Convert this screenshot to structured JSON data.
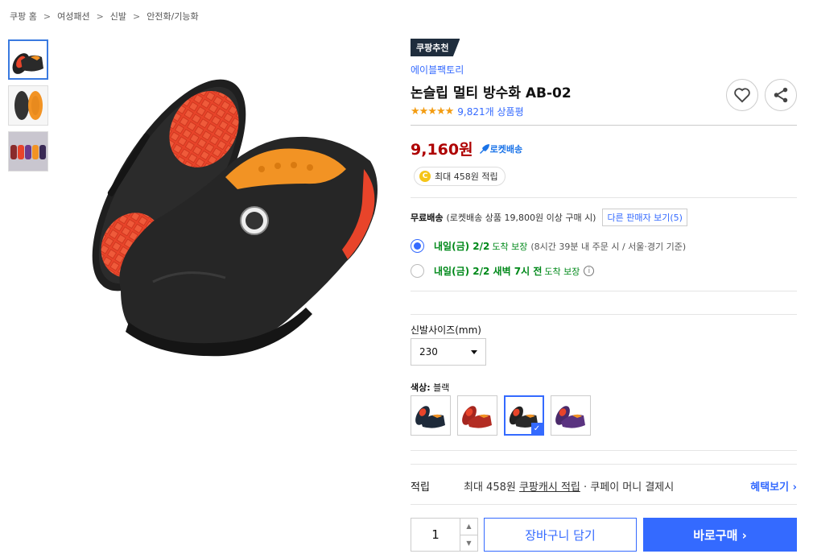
{
  "breadcrumb": [
    "쿠팡 홈",
    "여성패션",
    "신발",
    "안전화/기능화"
  ],
  "breadcrumb_sep": ">",
  "product": {
    "badge": "쿠팡추천",
    "brand": "에이블팩토리",
    "title": "논슬립 멀티 방수화 AB-02",
    "rating_stars": "★★★★★",
    "rating": 4.5,
    "review_count": "9,821개 상품평",
    "price": "9,160원",
    "rocket_label": "로켓배송",
    "reward_pill": "최대 458원 적립",
    "coin_symbol": "C"
  },
  "shipping": {
    "free_label": "무료배송",
    "condition": "(로켓배송 상품 19,800원 이상 구매 시)",
    "other_sellers": "다른 판매자 보기(5)",
    "options": [
      {
        "strong": "내일(금) 2/2",
        "mid": "도착 보장",
        "note": "(8시간 39분 내 주문 시 / 서울·경기 기준)",
        "selected": true
      },
      {
        "strong": "내일(금) 2/2 새벽 7시 전",
        "mid": "도착 보장",
        "note": "",
        "selected": false
      }
    ],
    "info_icon": "i"
  },
  "size": {
    "label": "신발사이즈(mm)",
    "value": "230"
  },
  "color": {
    "label": "색상:",
    "value": "블랙",
    "swatches": [
      "navy",
      "red",
      "black",
      "purple"
    ],
    "selected_index": 2,
    "check": "✓"
  },
  "reward": {
    "label": "적립",
    "prefix": "최대 458원 ",
    "link": "쿠팡캐시 적립",
    "suffix": " · 쿠페이 머니 결제시",
    "benefit": "혜택보기 ›"
  },
  "purchase": {
    "quantity": "1",
    "up": "▲",
    "down": "▼",
    "cart": "장바구니 담기",
    "buy": "바로구매 ›"
  },
  "colors": {
    "accent": "#346aff",
    "price": "#ae0000",
    "green": "#00891a",
    "badge_bg": "#1f2d3d",
    "sole_red": "#e8442a",
    "lining_orange": "#f29324"
  }
}
